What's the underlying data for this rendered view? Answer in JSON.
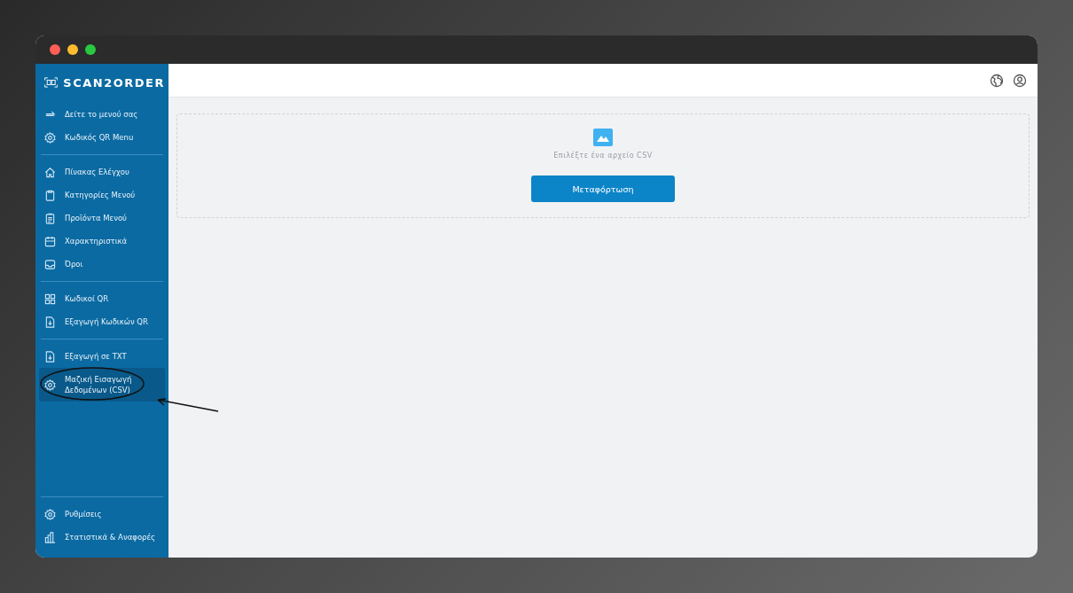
{
  "sidebar": {
    "logo": "SCAN2ORDER",
    "groups": [
      {
        "items": [
          {
            "label": "Δείτε το μενού σας",
            "kind": "return",
            "selected": false
          },
          {
            "label": "Κωδικός QR Menu",
            "kind": "gear",
            "selected": false
          }
        ]
      },
      {
        "items": [
          {
            "label": "Πίνακας Ελέγχου",
            "kind": "home",
            "selected": false
          },
          {
            "label": "Κατηγορίες Μενού",
            "kind": "clipboard",
            "selected": false
          },
          {
            "label": "Προϊόντα Μενού",
            "kind": "list",
            "selected": false
          },
          {
            "label": "Χαρακτηριστικά",
            "kind": "calendar",
            "selected": false
          },
          {
            "label": "Όροι",
            "kind": "inbox",
            "selected": false
          }
        ]
      },
      {
        "items": [
          {
            "label": "Κωδικοί QR",
            "kind": "grid",
            "selected": false
          },
          {
            "label": "Εξαγωγή Κωδικών QR",
            "kind": "download",
            "selected": false
          }
        ]
      },
      {
        "items": [
          {
            "label": "Εξαγωγή σε TXT",
            "kind": "download",
            "selected": false
          },
          {
            "label": "Μαζική Εισαγωγή Δεδομένων (CSV)",
            "kind": "gear",
            "selected": true
          }
        ]
      }
    ],
    "bottom": [
      {
        "label": "Ρυθμίσεις",
        "kind": "gear",
        "selected": false
      },
      {
        "label": "Στατιστικά & Αναφορές",
        "kind": "bars",
        "selected": false
      }
    ]
  },
  "upload": {
    "hint": "Επιλέξτε ένα αρχείο CSV",
    "button": "Μεταφόρτωση"
  }
}
